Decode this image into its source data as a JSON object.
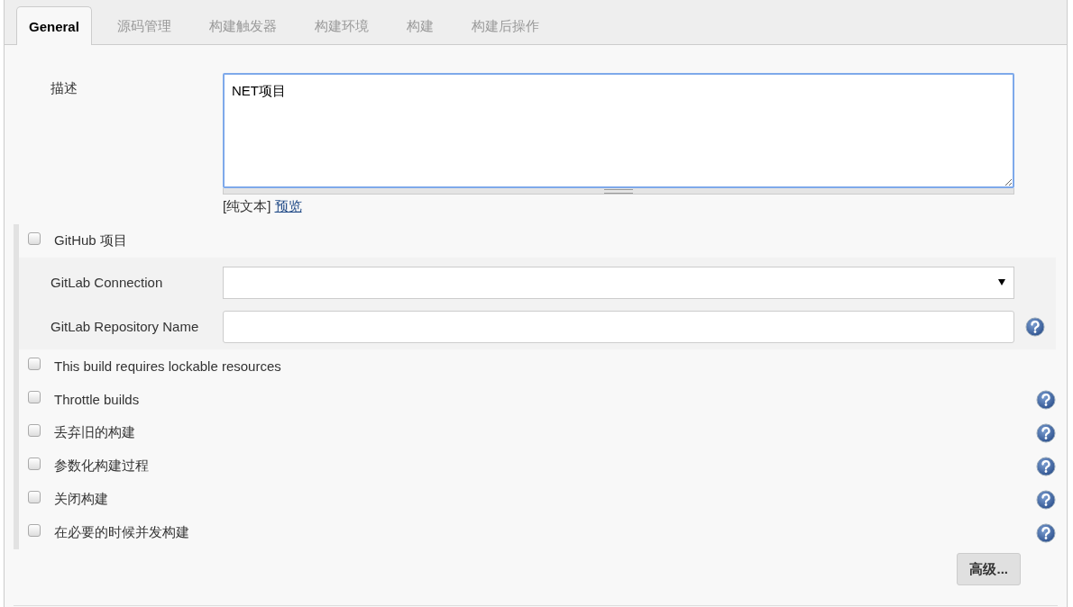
{
  "tabs": [
    {
      "label": "General",
      "selected": true
    },
    {
      "label": "源码管理",
      "selected": false
    },
    {
      "label": "构建触发器",
      "selected": false
    },
    {
      "label": "构建环境",
      "selected": false
    },
    {
      "label": "构建",
      "selected": false
    },
    {
      "label": "构建后操作",
      "selected": false
    }
  ],
  "description": {
    "label": "描述",
    "value": "NET项目",
    "format_note": "[纯文本]",
    "preview_link": "预览"
  },
  "github_project": {
    "label": "GitHub 项目",
    "checked": false
  },
  "gitlab_fields": [
    {
      "kind": "select",
      "label": "GitLab Connection",
      "help": false
    },
    {
      "kind": "text",
      "label": "GitLab Repository Name",
      "help": true
    }
  ],
  "options": [
    {
      "label": "This build requires lockable resources",
      "checked": false,
      "help": false
    },
    {
      "label": "Throttle builds",
      "checked": false,
      "help": true
    },
    {
      "label": "丢弃旧的构建",
      "checked": false,
      "help": true
    },
    {
      "label": "参数化构建过程",
      "checked": false,
      "help": true
    },
    {
      "label": "关闭构建",
      "checked": false,
      "help": true
    },
    {
      "label": "在必要的时候并发构建",
      "checked": false,
      "help": true
    }
  ],
  "advanced_button": "高级..."
}
